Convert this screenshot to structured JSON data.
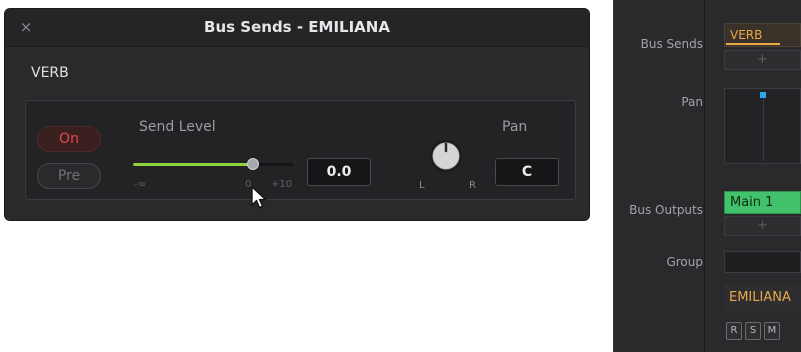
{
  "dialog": {
    "title": "Bus Sends - EMILIANA",
    "close_glyph": "×",
    "bus_name": "VERB",
    "on_label": "On",
    "pre_label": "Pre",
    "send_level_label": "Send Level",
    "send_level_value": "0.0",
    "fader_fraction": 0.75,
    "fader_ticks": {
      "min": "-∞",
      "zero": "0",
      "max": "+10"
    },
    "pan_label": "Pan",
    "pan_value": "C",
    "pan_knob": {
      "left_label": "L",
      "right_label": "R"
    },
    "colors": {
      "on_red": "#e5484a",
      "fader_green": "#8fd23b"
    }
  },
  "mixer": {
    "labels": {
      "bus_sends": "Bus Sends",
      "pan": "Pan",
      "bus_outputs": "Bus Outputs",
      "group": "Group"
    },
    "send_slot": "VERB",
    "plus_glyph": "+",
    "bus_output": "Main 1",
    "track_name": "EMILIANA",
    "rsm": [
      "R",
      "S",
      "M"
    ],
    "colors": {
      "send_orange": "#e9a84a",
      "output_green": "#41c26b",
      "pan_dot_blue": "#2ea8e8"
    }
  }
}
